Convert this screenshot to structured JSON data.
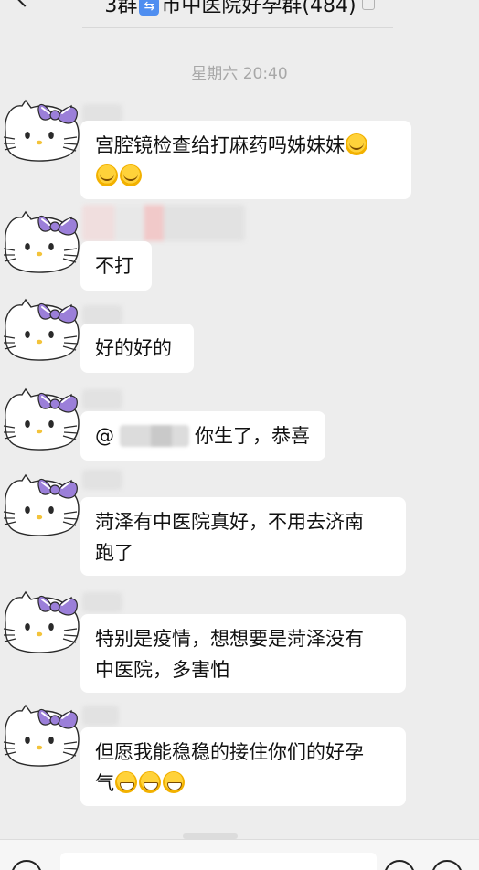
{
  "header": {
    "title_pre": "3群",
    "swap_icon": "⇆",
    "title_post": "市中医院好孕群(484)",
    "icons": [
      "back-arrow-icon",
      "mute-icon",
      "more-icon"
    ]
  },
  "timestamp": "星期六 20:40",
  "messages": [
    {
      "text": "宫腔镜检查给打麻药吗姊妹妹",
      "emojis_inline": [
        "cry"
      ],
      "emojis_line2": [
        "cry",
        "cry"
      ]
    },
    {
      "text": "不打"
    },
    {
      "text": "好的好的"
    },
    {
      "mention_prefix": "@",
      "text": "你生了，恭喜"
    },
    {
      "text": "菏泽有中医院真好，不用去济南",
      "line2": "跑了"
    },
    {
      "text": "特别是疫情，想想要是菏泽没有",
      "line2": "中医院，多害怕"
    },
    {
      "text": "但愿我能稳稳的接住你们的好孕",
      "line2": "气",
      "emojis_line2": [
        "grin",
        "grin",
        "grin"
      ]
    }
  ],
  "colors": {
    "background": "#ededed",
    "bubble": "#ffffff",
    "bow": "#9b7fd9",
    "accent": "#4f8ef0"
  }
}
